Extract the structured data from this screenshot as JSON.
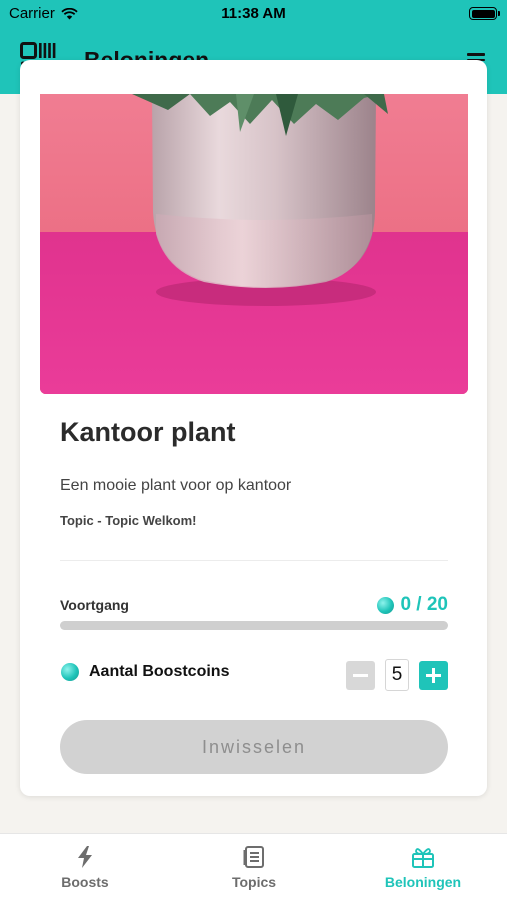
{
  "status_bar": {
    "carrier": "Carrier",
    "time": "11:38 AM"
  },
  "header": {
    "title": "Beloningen",
    "logo_icon": "qr-logo-icon",
    "menu_icon": "hamburger-menu-icon"
  },
  "reward": {
    "image": "office-plant-in-pink-pot-photo",
    "title": "Kantoor plant",
    "description": "Een mooie plant voor op kantoor",
    "topic": "Topic - Topic Welkom!"
  },
  "progress": {
    "label": "Voortgang",
    "value_text": "0 / 20",
    "fraction": 0
  },
  "boostcoins": {
    "label": "Aantal Boostcoins",
    "quantity": "5"
  },
  "redeem_button": {
    "label": "Inwisselen"
  },
  "tabs": [
    {
      "label": "Boosts",
      "icon": "lightning-icon",
      "active": false
    },
    {
      "label": "Topics",
      "icon": "book-icon",
      "active": false
    },
    {
      "label": "Beloningen",
      "icon": "gift-icon",
      "active": true
    }
  ],
  "colors": {
    "accent": "#1fc4b9",
    "disabled": "#d2d2d2",
    "background": "#f5f3ef"
  }
}
